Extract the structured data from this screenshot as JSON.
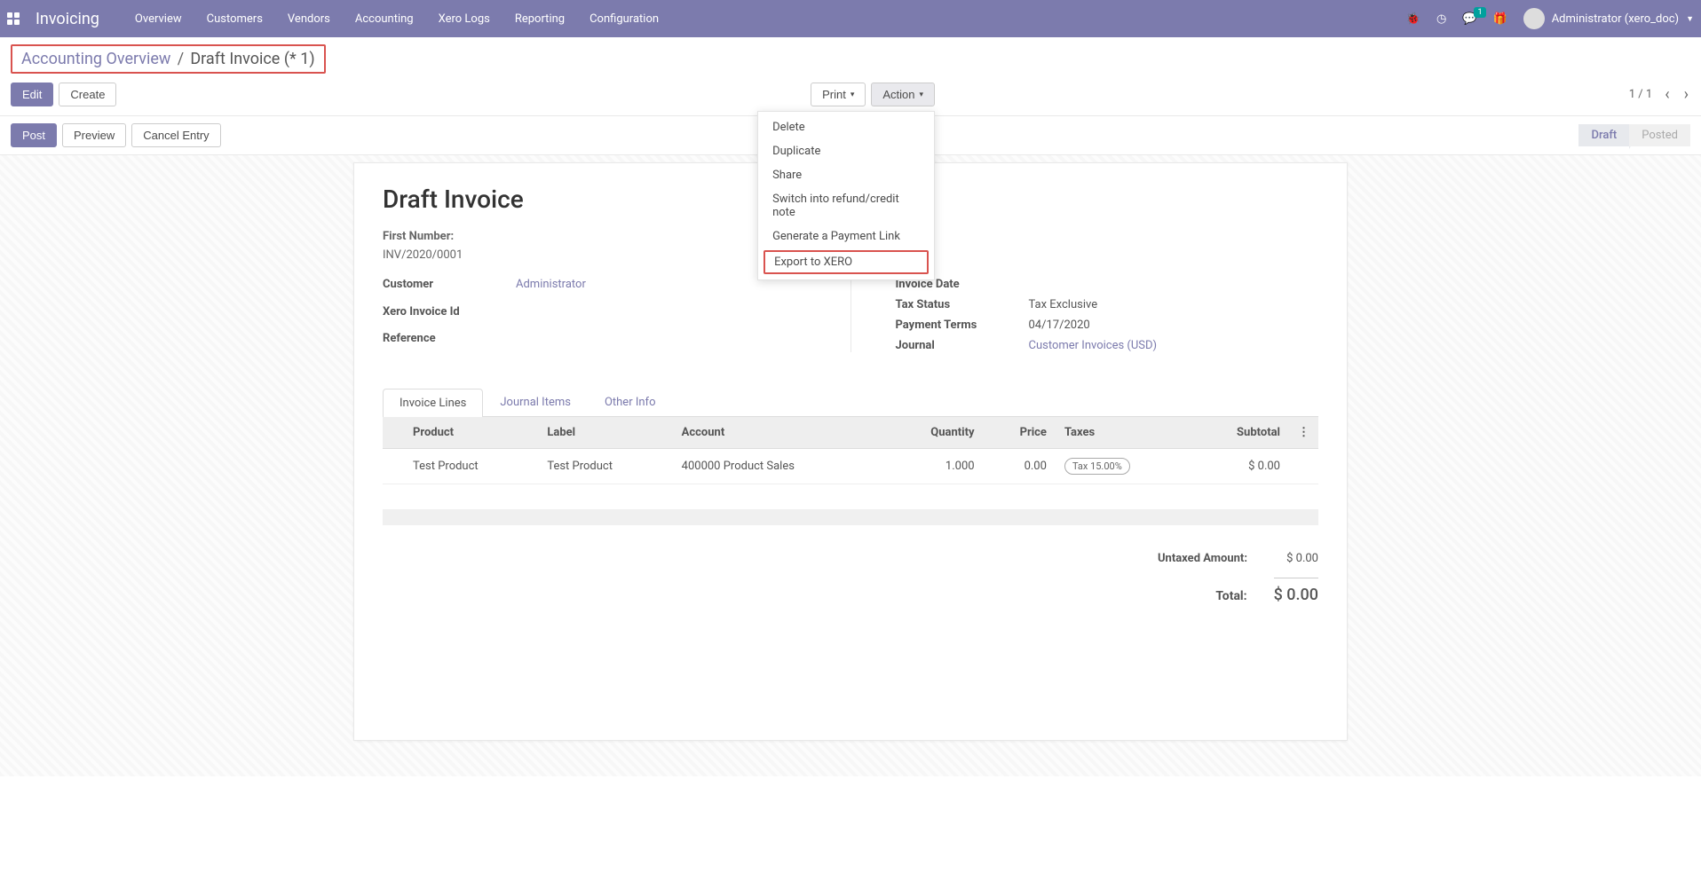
{
  "nav": {
    "brand": "Invoicing",
    "menus": [
      "Overview",
      "Customers",
      "Vendors",
      "Accounting",
      "Xero Logs",
      "Reporting",
      "Configuration"
    ],
    "msg_badge": "1",
    "user": "Administrator (xero_doc)"
  },
  "breadcrumb": {
    "parent": "Accounting Overview",
    "current": "Draft Invoice (* 1)"
  },
  "cp": {
    "edit": "Edit",
    "create": "Create",
    "print": "Print",
    "action": "Action",
    "pager": "1 / 1"
  },
  "action_menu": [
    "Delete",
    "Duplicate",
    "Share",
    "Switch into refund/credit note",
    "Generate a Payment Link",
    "Export to XERO"
  ],
  "statusbar": {
    "post": "Post",
    "preview": "Preview",
    "cancel": "Cancel Entry",
    "draft": "Draft",
    "posted": "Posted"
  },
  "form": {
    "title": "Draft Invoice",
    "first_number_label": "First Number:",
    "first_number": "INV/2020/0001",
    "left": {
      "customer_l": "Customer",
      "customer_v": "Administrator",
      "xero_l": "Xero Invoice Id",
      "ref_l": "Reference"
    },
    "right": {
      "date_l": "Invoice Date",
      "taxstatus_l": "Tax Status",
      "taxstatus_v": "Tax Exclusive",
      "terms_l": "Payment Terms",
      "terms_v": "04/17/2020",
      "journal_l": "Journal",
      "journal_v": "Customer Invoices (USD)"
    }
  },
  "tabs": [
    "Invoice Lines",
    "Journal Items",
    "Other Info"
  ],
  "table": {
    "cols": [
      "Product",
      "Label",
      "Account",
      "Quantity",
      "Price",
      "Taxes",
      "Subtotal"
    ],
    "rows": [
      {
        "product": "Test Product",
        "label": "Test Product",
        "account": "400000 Product Sales",
        "qty": "1.000",
        "price": "0.00",
        "tax": "Tax 15.00%",
        "subtotal": "$ 0.00"
      }
    ]
  },
  "totals": {
    "untaxed_l": "Untaxed Amount:",
    "untaxed_v": "$ 0.00",
    "total_l": "Total:",
    "total_v": "$ 0.00"
  }
}
